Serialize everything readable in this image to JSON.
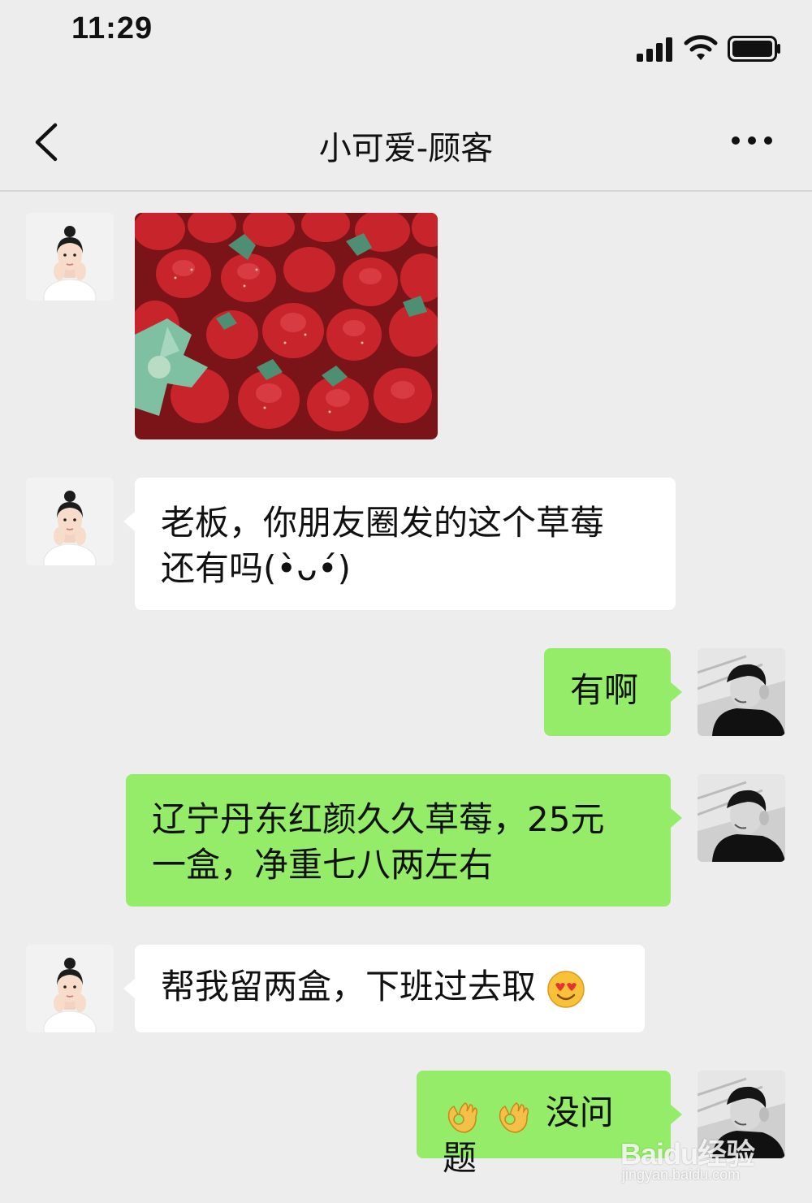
{
  "status_bar": {
    "time": "11:29"
  },
  "nav": {
    "title": "小可爱-顾客",
    "back_icon": "chevron-left-icon",
    "more_icon": "ellipsis-icon"
  },
  "messages": [
    {
      "side": "in",
      "type": "image",
      "content": "strawberry-photo"
    },
    {
      "side": "in",
      "type": "text",
      "line1": "老板，你朋友圈发的这个草莓",
      "line2": "还有吗(•̀ᴗ•́)"
    },
    {
      "side": "out",
      "type": "text",
      "text": "有啊"
    },
    {
      "side": "out",
      "type": "text",
      "line1": "辽宁丹东红颜久久草莓，25元",
      "line2": "一盒，净重七八两左右"
    },
    {
      "side": "in",
      "type": "text",
      "text": "帮我留两盒，下班过去取",
      "emoji": "heart-eyes-emoji"
    },
    {
      "side": "out",
      "type": "text",
      "emojis": [
        "ok-hand-emoji",
        "ok-hand-emoji"
      ],
      "text": "没问题"
    }
  ],
  "watermark": {
    "logo": "Baidu经验",
    "url": "jingyan.baidu.com"
  },
  "colors": {
    "background": "#ededed",
    "incoming_bubble": "#ffffff",
    "outgoing_bubble": "#95ec69"
  }
}
